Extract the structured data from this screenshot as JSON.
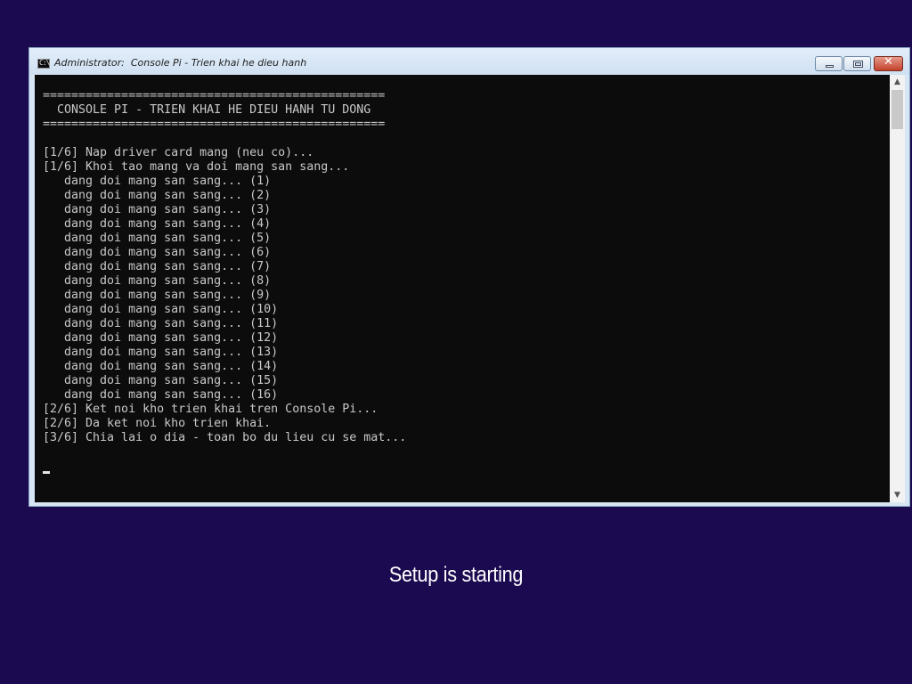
{
  "window": {
    "title": "Administrator:  Console Pi - Trien khai he dieu hanh",
    "icon_text": "C:\\",
    "controls": {
      "minimize_icon": "minimize-icon",
      "maximize_icon": "restore-icon",
      "close_icon": "close-icon",
      "close_glyph": "✕"
    }
  },
  "console": {
    "lines": [
      "================================================",
      "  CONSOLE PI - TRIEN KHAI HE DIEU HANH TU DONG",
      "================================================",
      "",
      "[1/6] Nap driver card mang (neu co)...",
      "[1/6] Khoi tao mang va doi mang san sang...",
      "   dang doi mang san sang... (1)",
      "   dang doi mang san sang... (2)",
      "   dang doi mang san sang... (3)",
      "   dang doi mang san sang... (4)",
      "   dang doi mang san sang... (5)",
      "   dang doi mang san sang... (6)",
      "   dang doi mang san sang... (7)",
      "   dang doi mang san sang... (8)",
      "   dang doi mang san sang... (9)",
      "   dang doi mang san sang... (10)",
      "   dang doi mang san sang... (11)",
      "   dang doi mang san sang... (12)",
      "   dang doi mang san sang... (13)",
      "   dang doi mang san sang... (14)",
      "   dang doi mang san sang... (15)",
      "   dang doi mang san sang... (16)",
      "[2/6] Ket noi kho trien khai tren Console Pi...",
      "[2/6] Da ket noi kho trien khai.",
      "[3/6] Chia lai o dia - toan bo du lieu cu se mat..."
    ],
    "background": "#0c0c0c",
    "foreground": "#c8c8c8"
  },
  "scrollbar": {
    "up_glyph": "▲",
    "down_glyph": "▼"
  },
  "status_text": "Setup is starting",
  "colors": {
    "desktop": "#1c0a50",
    "window_frame": "#d6e6f5",
    "close_button": "#c2412b"
  }
}
